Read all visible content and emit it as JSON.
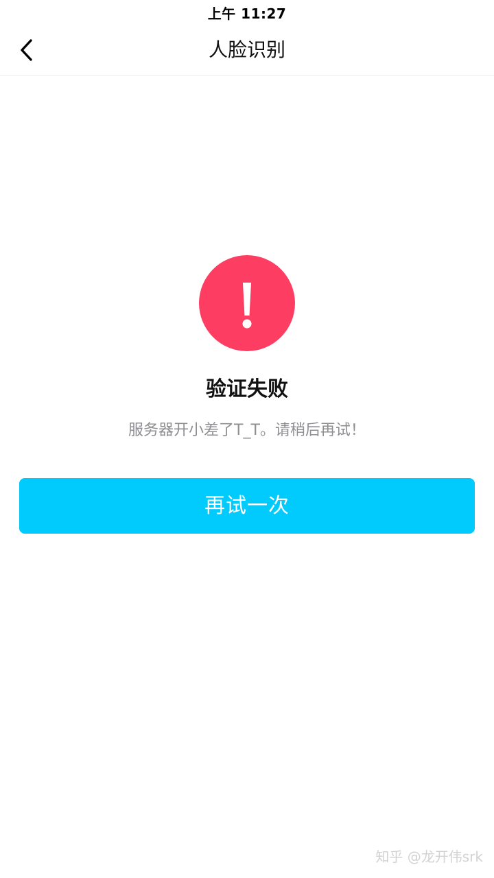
{
  "status_bar": {
    "time": "上午 11:27"
  },
  "nav": {
    "title": "人脸识别",
    "back_icon": "chevron-left-icon"
  },
  "result": {
    "icon": "exclamation-icon",
    "status_color": "#fd3d61",
    "title": "验证失败",
    "message": "服务器开小差了T_T。请稍后再试！"
  },
  "actions": {
    "retry_label": "再试一次",
    "accent_color": "#00cbfc"
  },
  "watermark": {
    "text": "知乎 @龙开伟srk"
  }
}
